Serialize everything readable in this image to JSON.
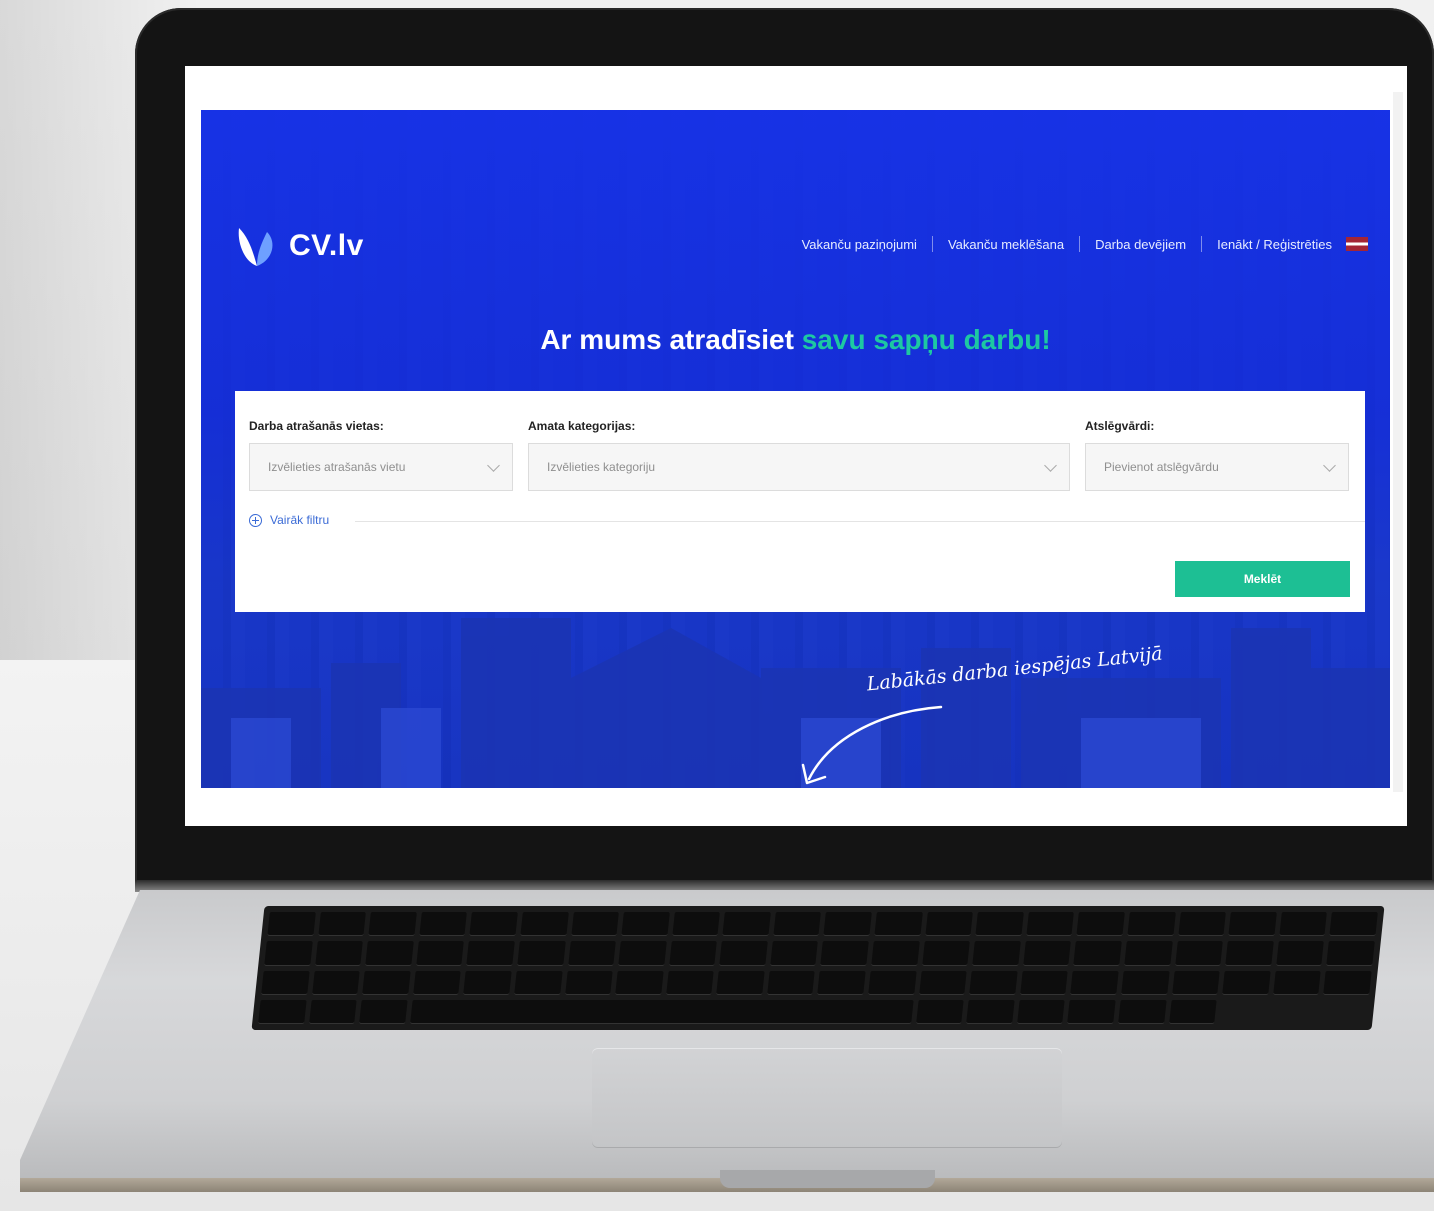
{
  "site": {
    "logo_text": "CV.lv",
    "nav": [
      {
        "label": "Vakanču paziņojumi"
      },
      {
        "label": "Vakanču meklēšana"
      },
      {
        "label": "Darba devējiem"
      },
      {
        "label": "Ienākt / Reģistrēties"
      }
    ],
    "language_flag": "latvia-flag-icon",
    "headline_start": "Ar mums atradīsiet ",
    "headline_accent": "savu sapņu darbu!",
    "search": {
      "location_label": "Darba atrašanās vietas:",
      "location_placeholder": "Izvēlieties atrašanās vietu",
      "category_label": "Amata kategorijas:",
      "category_placeholder": "Izvēlieties kategoriju",
      "keyword_label": "Atslēgvārdi:",
      "keyword_placeholder": "Pievienot atslēgvārdu",
      "more_filters_label": "Vairāk filtru",
      "search_button_label": "Meklēt"
    },
    "tagline": "Labākās darba iespējas Latvijā"
  },
  "colors": {
    "hero_blue": "#1732e6",
    "accent_green": "#1dc8a2",
    "button_green": "#1dbf94",
    "link_blue": "#3b6bd6"
  }
}
